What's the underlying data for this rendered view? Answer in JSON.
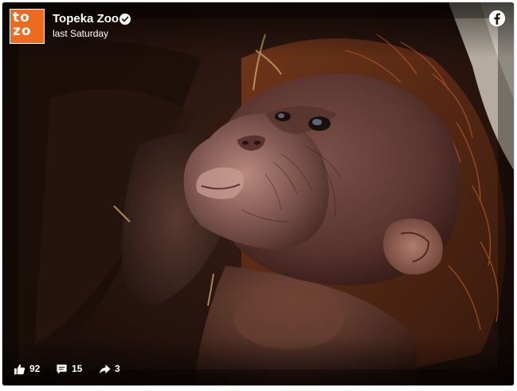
{
  "post": {
    "page_name": "Topeka Zoo",
    "timestamp": "last Saturday",
    "avatar_text": "to\nzo",
    "verified": true,
    "platform_icon": "facebook-icon",
    "image_description_icon": "photo-icon"
  },
  "stats": {
    "likes": "92",
    "comments": "15",
    "shares": "3"
  },
  "colors": {
    "avatar_bg": "#ee6a1f",
    "verified_badge": "#ffffff",
    "text": "#ffffff"
  },
  "icons": {
    "likes": "thumbs-up-icon",
    "comments": "comment-bubble-icon",
    "shares": "share-arrow-icon"
  }
}
